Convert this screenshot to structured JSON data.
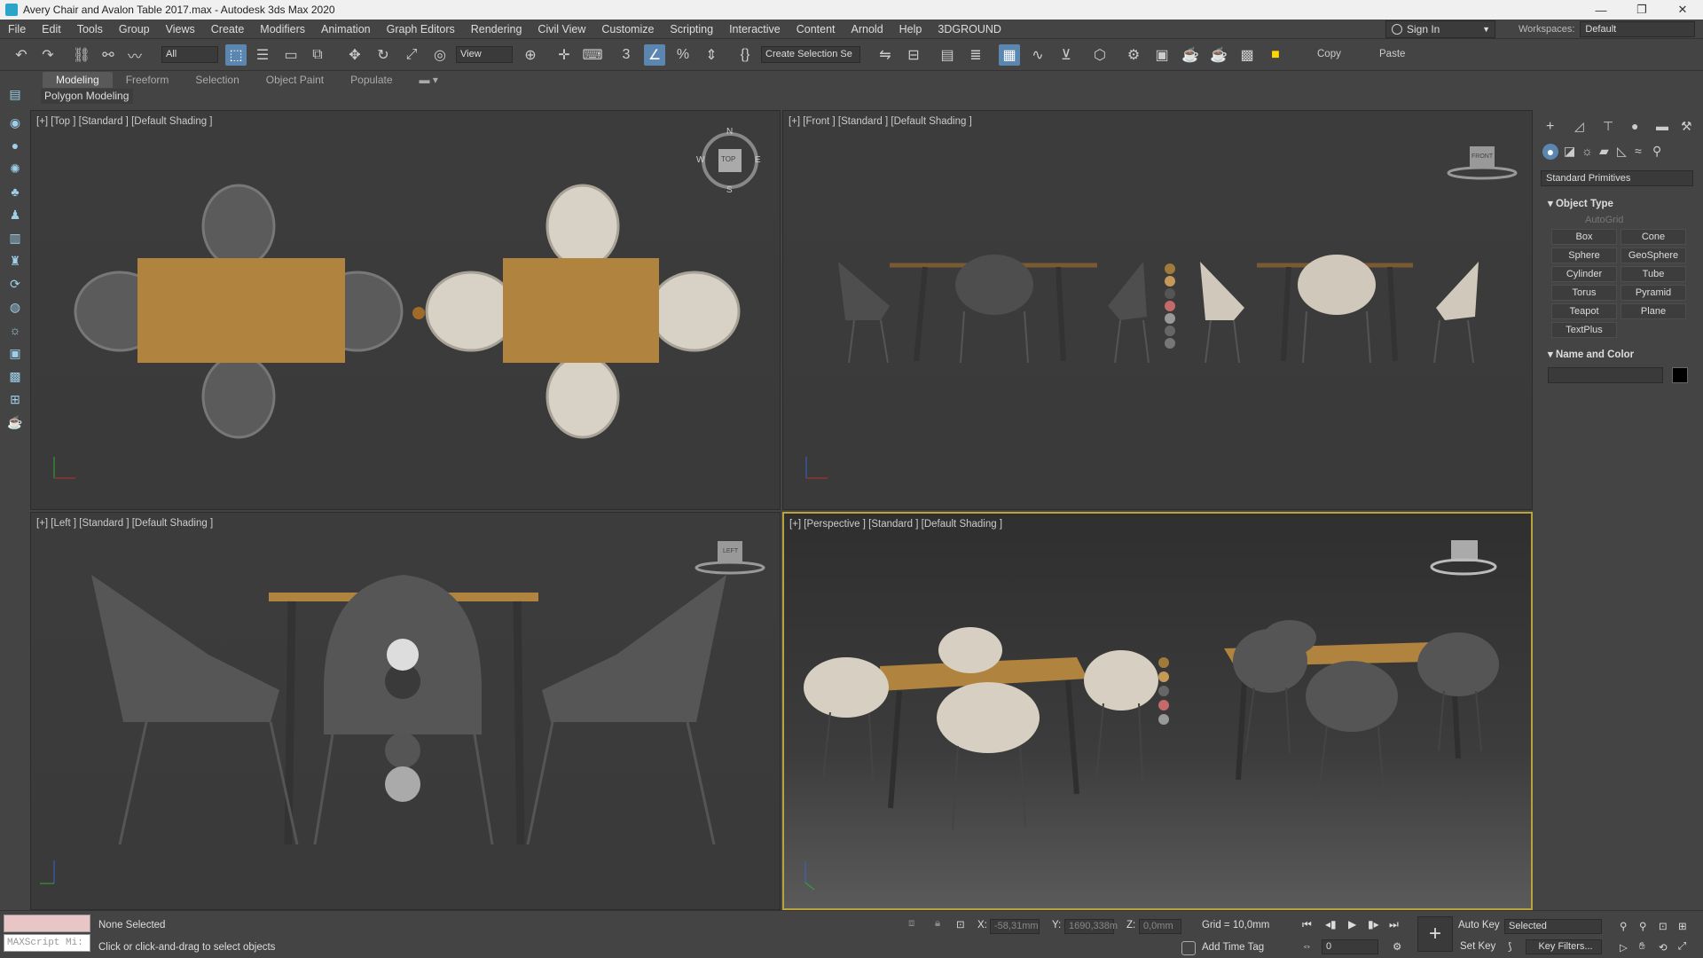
{
  "window": {
    "title": "Avery Chair and Avalon Table 2017.max - Autodesk 3ds Max 2020",
    "controls": [
      "—",
      "❐",
      "✕"
    ]
  },
  "menu": [
    "File",
    "Edit",
    "Tools",
    "Group",
    "Views",
    "Create",
    "Modifiers",
    "Animation",
    "Graph Editors",
    "Rendering",
    "Civil View",
    "Customize",
    "Scripting",
    "Interactive",
    "Content",
    "Arnold",
    "Help",
    "3DGROUND"
  ],
  "account": {
    "sign_in": "Sign In",
    "workspaces_label": "Workspaces:",
    "workspace_value": "Default"
  },
  "toolbar": {
    "filter": "All",
    "ref_coord": "View",
    "selection_set": "Create Selection Se",
    "copy": "Copy",
    "paste": "Paste"
  },
  "ribbon": {
    "tabs": [
      "Modeling",
      "Freeform",
      "Selection",
      "Object Paint",
      "Populate"
    ],
    "active_tab": "Modeling",
    "panel_label": "Polygon Modeling"
  },
  "viewports": {
    "top": {
      "label": "[+] [Top ] [Standard ] [Default Shading ]",
      "compass": [
        "N",
        "E",
        "S",
        "W"
      ],
      "cube": "TOP"
    },
    "front": {
      "label": "[+] [Front ] [Standard ] [Default Shading ]",
      "cube": "FRONT"
    },
    "left": {
      "label": "[+] [Left ] [Standard ] [Default Shading ]",
      "cube": "LEFT"
    },
    "perspective": {
      "label": "[+] [Perspective ] [Standard ] [Default Shading ]"
    }
  },
  "command_panel": {
    "dropdown": "Standard Primitives",
    "object_type_title": "Object Type",
    "autogrid": "AutoGrid",
    "buttons": [
      "Box",
      "Cone",
      "Sphere",
      "GeoSphere",
      "Cylinder",
      "Tube",
      "Torus",
      "Pyramid",
      "Teapot",
      "Plane",
      "TextPlus"
    ],
    "name_color_title": "Name and Color",
    "color_swatch": "#000000"
  },
  "status": {
    "maxscript": "MAXScript Mi:",
    "selection": "None Selected",
    "prompt": "Click or click-and-drag to select objects",
    "x_label": "X:",
    "x_value": "-58,31mm",
    "y_label": "Y:",
    "y_value": "1690,338m",
    "z_label": "Z:",
    "z_value": "0,0mm",
    "grid": "Grid = 10,0mm",
    "add_time_tag": "Add Time Tag",
    "auto_key": "Auto Key",
    "set_key": "Set Key",
    "key_mode": "Selected",
    "key_filters": "Key Filters...",
    "frame": "0"
  }
}
